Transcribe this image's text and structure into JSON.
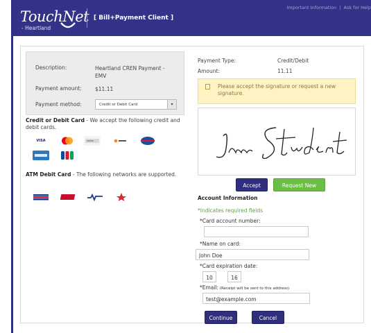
{
  "header": {
    "logo_main": "TouchNet",
    "logo_sub": "- Heartland",
    "client_name": "[ Bill+Payment Client ]",
    "links": [
      "Important Information",
      "Ask for Help"
    ],
    "link_separator": "|"
  },
  "summary": {
    "description_label": "Description:",
    "description_value": "Heartland CREN Payment - EMV",
    "amount_label": "Payment amount:",
    "amount_value": "$11.11",
    "method_label": "Payment method:",
    "method_value": "Credit or Debit Card",
    "method_arrow": "▾"
  },
  "credit_section": {
    "title": "Credit or Debit Card",
    "text": " - We accept the following credit and debit cards.",
    "cards": [
      {
        "name": "visa-logo",
        "label": "VISA",
        "bg": "#ffffff",
        "fg": "#1a1f71"
      },
      {
        "name": "mastercard-logo",
        "label": "",
        "bg": "#ffffff",
        "fg": "#eb001b"
      },
      {
        "name": "card-logo-generic",
        "label": "",
        "bg": "#f4f4f4",
        "fg": "#888888"
      },
      {
        "name": "discover-logo",
        "label": "DISCOVER",
        "bg": "#ffffff",
        "fg": "#f58220"
      },
      {
        "name": "diners-club-logo",
        "label": "",
        "bg": "#ffffff",
        "fg": "#1b4f9c"
      },
      {
        "name": "american-express-logo",
        "label": "AMERICAN EXPRESS",
        "bg": "#2e77bb",
        "fg": "#ffffff"
      },
      {
        "name": "jcb-logo",
        "label": "JCB",
        "bg": "#ffffff",
        "fg": "#0b4ea2"
      }
    ]
  },
  "atm_section": {
    "title": "ATM Debit Card",
    "text": " - The following networks are supported.",
    "networks": [
      {
        "name": "network-logo-1",
        "label": "",
        "bg": "#ffffff",
        "fg": "#1d3b8c"
      },
      {
        "name": "nyce-logo",
        "label": "NYCE",
        "bg": "#ffffff",
        "fg": "#c8102e"
      },
      {
        "name": "pulse-logo",
        "label": "PULSE",
        "bg": "#ffffff",
        "fg": "#1d3b8c"
      },
      {
        "name": "star-logo",
        "label": "STAR",
        "bg": "#ffffff",
        "fg": "#d7282f"
      }
    ]
  },
  "payment": {
    "type_label": "Payment Type:",
    "type_value": "Credit/Debit",
    "amount_label": "Amount:",
    "amount_value": "11.11",
    "alert_text": "Please accept the signature or request a new signature.",
    "signature_text": "Jane Student",
    "accept_label": "Accept",
    "request_label": "Request New"
  },
  "account": {
    "title": "Account Information",
    "required_note": "*Indicates required fields",
    "card_number_label": "*Card account number:",
    "card_number_value": "",
    "name_label": "*Name on card:",
    "name_value": "John Doe",
    "expiration_label": "*Card expiration date:",
    "exp_month": "10",
    "exp_year": "16",
    "email_label": "*Email:",
    "email_note": " (Receipt will be sent to this address)",
    "email_value": "test@example.com",
    "continue_label": "Continue",
    "cancel_label": "Cancel"
  },
  "colors": {
    "header_bg": "#323388",
    "button_navy": "#2f2f7e",
    "button_green": "#6bbd46",
    "alert_bg": "#fff3c3",
    "required_green": "#5aa63a"
  }
}
